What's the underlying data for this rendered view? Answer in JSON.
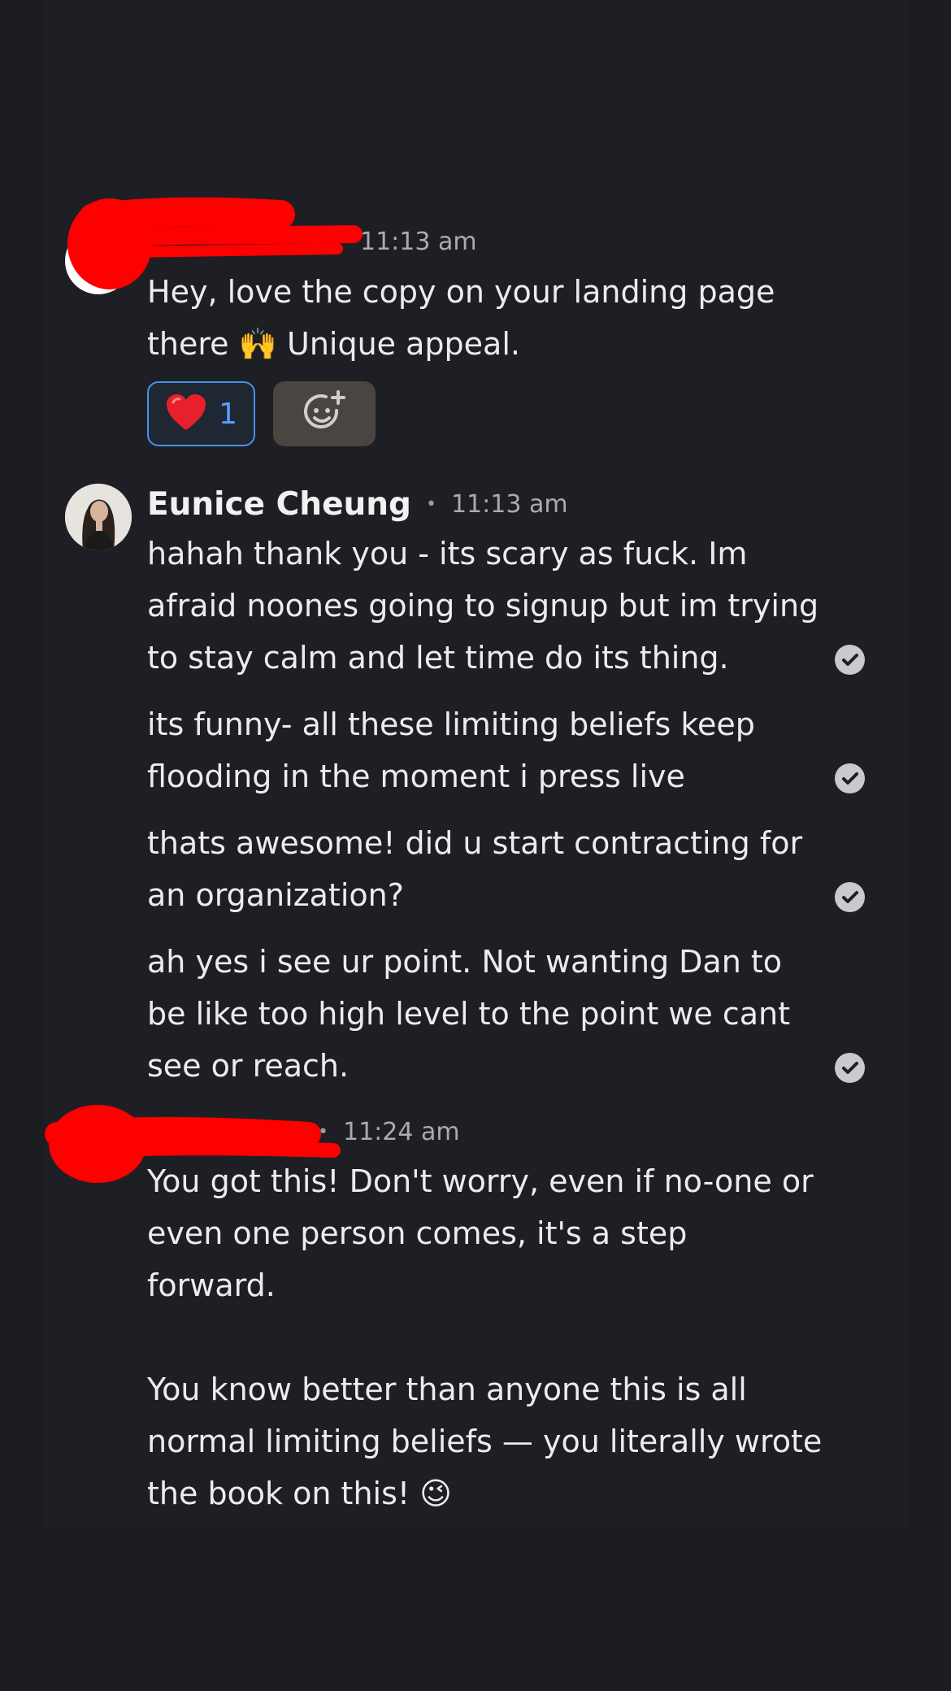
{
  "messages": [
    {
      "author": "",
      "time": "11:13 am",
      "text": "Hey, love the copy on your landing page\nthere 🙌 Unique appeal.",
      "reactions": [
        {
          "icon": "red-heart-icon",
          "emoji": "❤️",
          "count": "1",
          "selected": true
        },
        {
          "icon": "add-reaction-icon"
        }
      ]
    },
    {
      "author": "Eunice Cheung",
      "time": "11:13 am",
      "paragraphs": [
        "hahah thank you - its scary as fuck. Im\nafraid noones going to signup but im trying\nto stay calm and let time do its thing.",
        "its funny- all these limiting beliefs keep\nflooding in the moment i press live",
        "thats awesome! did u start contracting for\nan organization?",
        "ah yes i see ur point. Not wanting Dan to\nbe like too high level to the point we cant\nsee or reach."
      ],
      "status_icon": "check-circle-icon"
    },
    {
      "author": "",
      "time": "11:24 am",
      "text": "You got this! Don't worry, even if no-one or\neven one person comes, it's a step\nforward.\n\nYou know better than anyone this is all\nnormal limiting beliefs — you literally wrote\nthe book on this! 😉"
    }
  ],
  "separator": "•",
  "colors": {
    "background": "#1b1d22",
    "text": "#ececec",
    "timestamp": "#a9abb0",
    "reaction_border": "#4a8ff0",
    "redaction": "#ff0000"
  }
}
